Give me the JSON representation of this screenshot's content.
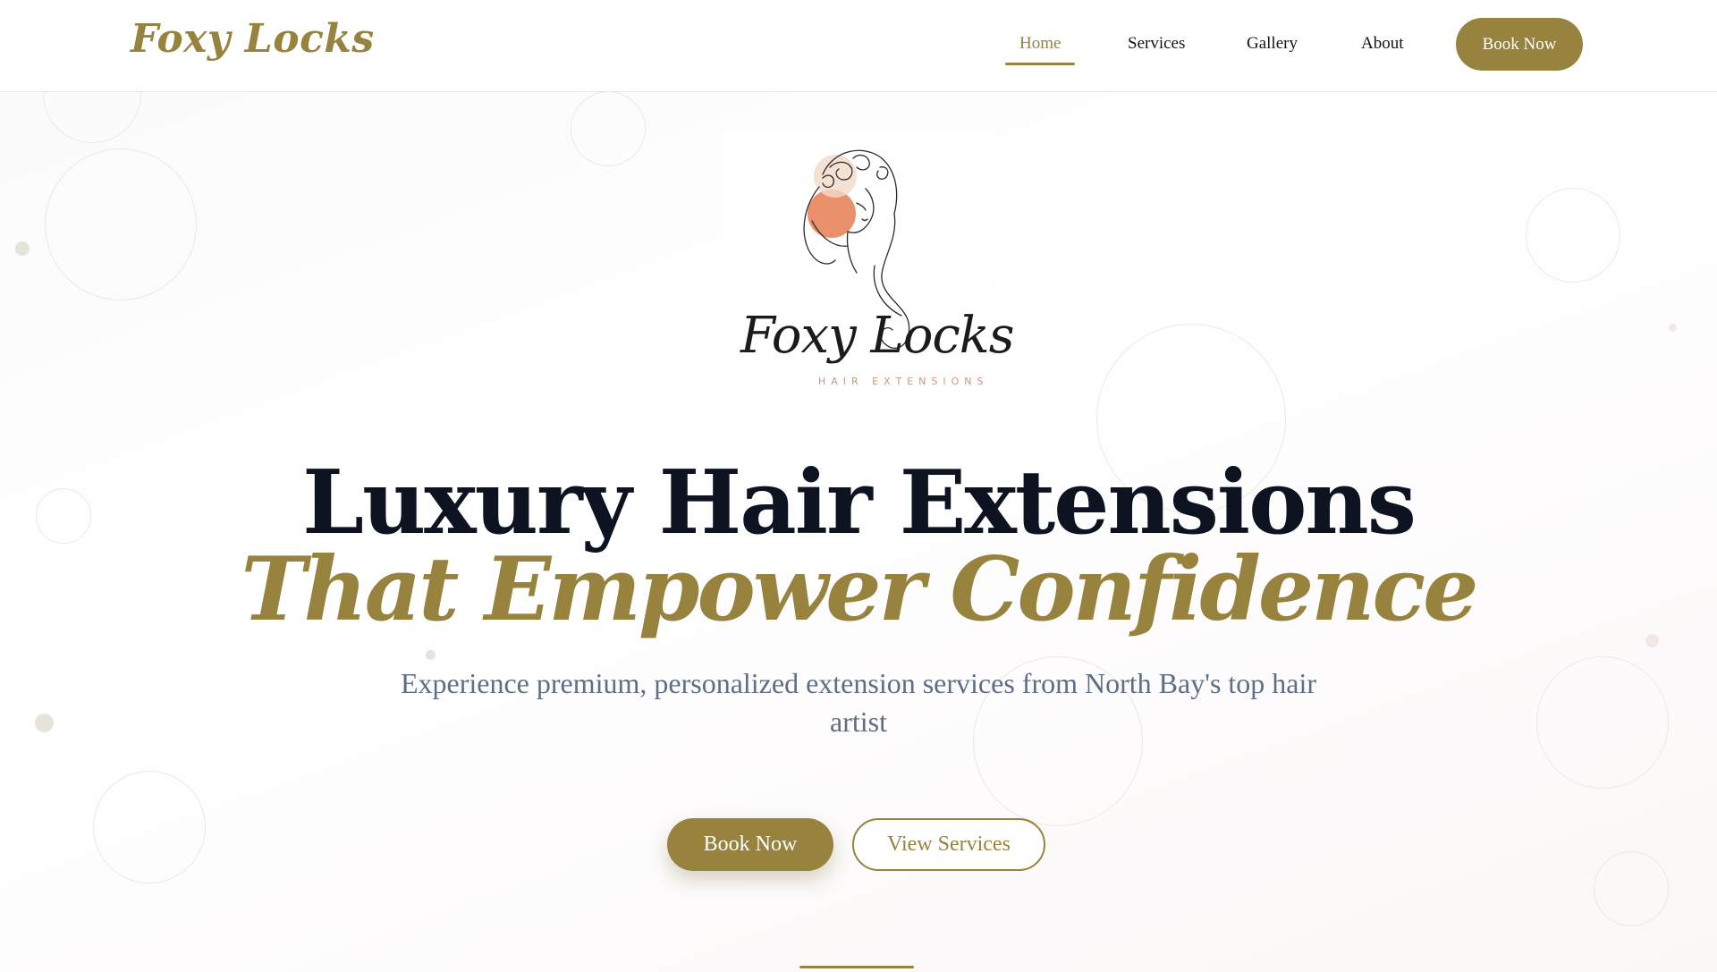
{
  "header": {
    "brand": "Foxy Locks",
    "nav": [
      {
        "label": "Home",
        "active": true
      },
      {
        "label": "Services",
        "active": false
      },
      {
        "label": "Gallery",
        "active": false
      },
      {
        "label": "About",
        "active": false
      }
    ],
    "cta_label": "Book Now"
  },
  "logo": {
    "script": "Foxy Locks",
    "subtitle": "HAIR EXTENSIONS",
    "icon": "woman-line-art-icon"
  },
  "hero": {
    "headline": "Luxury Hair Extensions",
    "headline_accent": "That Empower Confidence",
    "subtitle": "Experience premium, personalized extension services from North Bay's top hair artist",
    "primary_cta": "Book Now",
    "secondary_cta": "View Services"
  },
  "colors": {
    "accent": "#97833e",
    "heading": "#0e1321",
    "subtext": "#5f6e86",
    "logo_blush": "#e8845a"
  }
}
